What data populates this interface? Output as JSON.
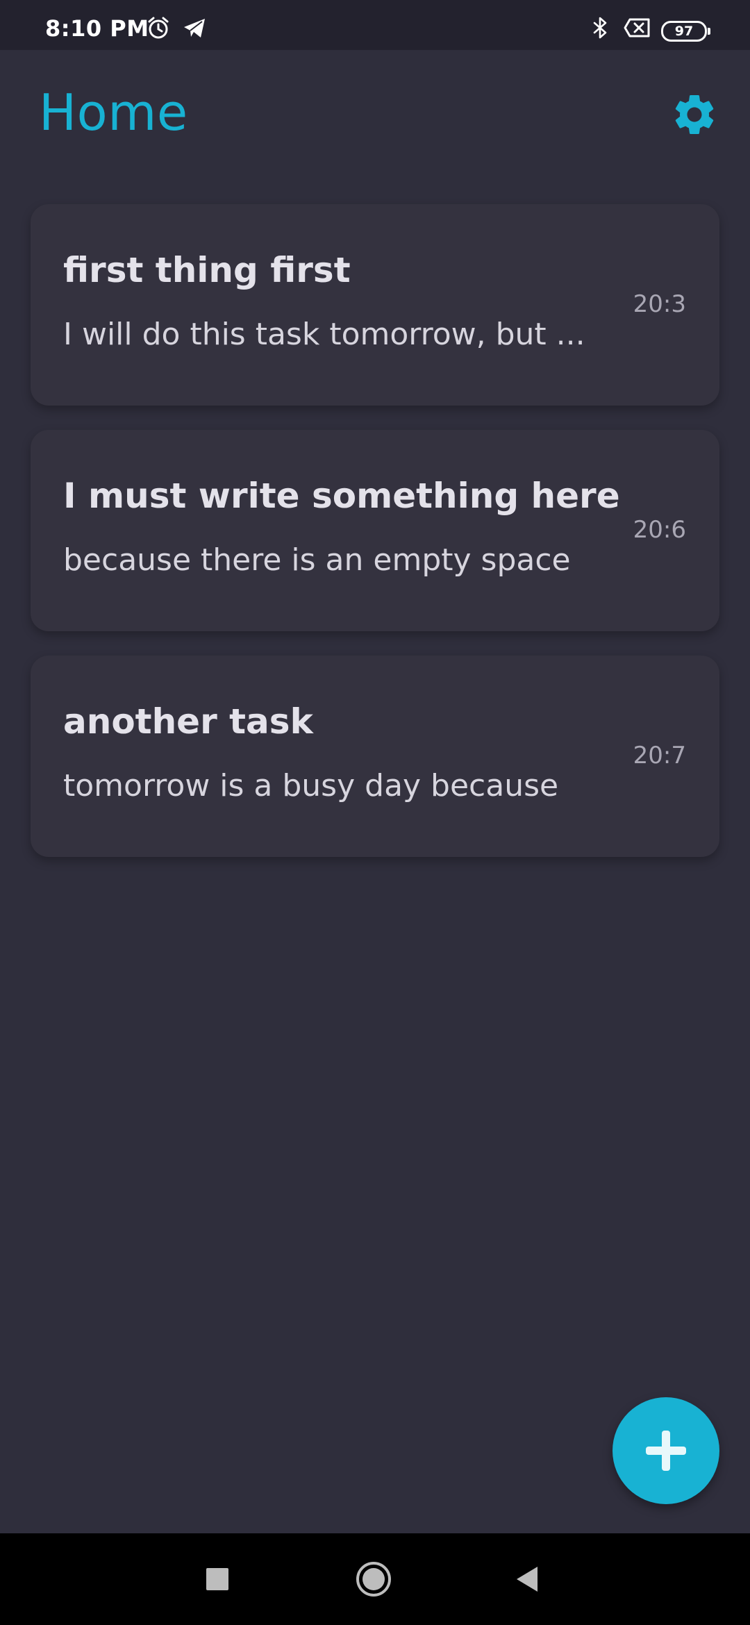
{
  "status_bar": {
    "time": "8:10 PM",
    "battery": "97",
    "icons": [
      "alarm-icon",
      "telegram-icon",
      "bluetooth-icon",
      "no-sim-icon",
      "battery-icon"
    ]
  },
  "header": {
    "title": "Home",
    "settings_icon": "gear-icon"
  },
  "tasks": [
    {
      "title": "first thing first",
      "description": "I will do this task tomorrow, but ...",
      "time": "20:3"
    },
    {
      "title": "I must write something here",
      "description": "because there is an empty space",
      "time": "20:6"
    },
    {
      "title": "another task",
      "description": "tomorrow is a busy day because",
      "time": "20:7"
    }
  ],
  "fab": {
    "icon": "plus-icon"
  },
  "nav_bar": {
    "buttons": [
      "recent-apps-icon",
      "home-icon",
      "back-icon"
    ]
  },
  "colors": {
    "accent": "#18b2d3",
    "background": "#2f2e3c",
    "card": "#34323f",
    "status_bar": "#23222e",
    "nav_bar": "#000000"
  }
}
